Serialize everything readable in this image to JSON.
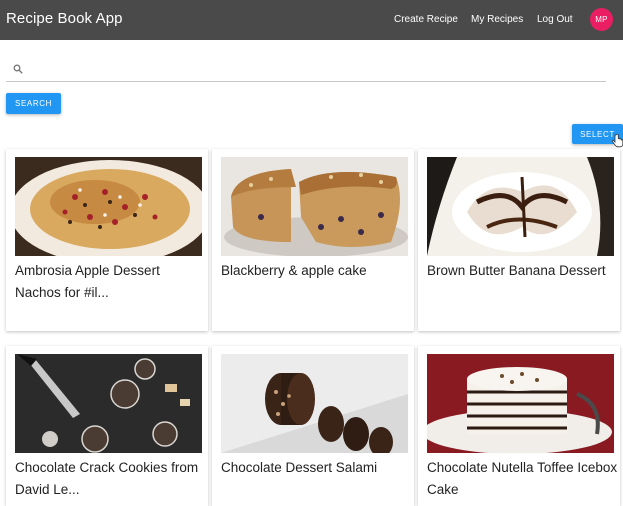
{
  "app": {
    "title": "Recipe Book App"
  },
  "nav": {
    "create": "Create Recipe",
    "my_recipes": "My Recipes",
    "logout": "Log Out",
    "avatar_initials": "MP",
    "avatar_color": "#e91e63"
  },
  "search": {
    "placeholder": "",
    "value": "",
    "button_label": "SEARCH"
  },
  "select_button_label": "SELECT",
  "colors": {
    "appbar": "#4a4a4a",
    "accent": "#2196f3"
  },
  "recipes": [
    {
      "title": "Ambrosia Apple Dessert Nachos for #il...",
      "image": "nachos-image"
    },
    {
      "title": "Blackberry & apple cake",
      "image": "cake-image"
    },
    {
      "title": "Brown Butter Banana Dessert",
      "image": "banana-dessert-image"
    },
    {
      "title": "Chocolate Crack Cookies from David Le...",
      "image": "cookies-image"
    },
    {
      "title": "Chocolate Dessert Salami",
      "image": "salami-image"
    },
    {
      "title": "Chocolate Nutella Toffee Icebox Cake",
      "image": "icebox-cake-image"
    }
  ]
}
